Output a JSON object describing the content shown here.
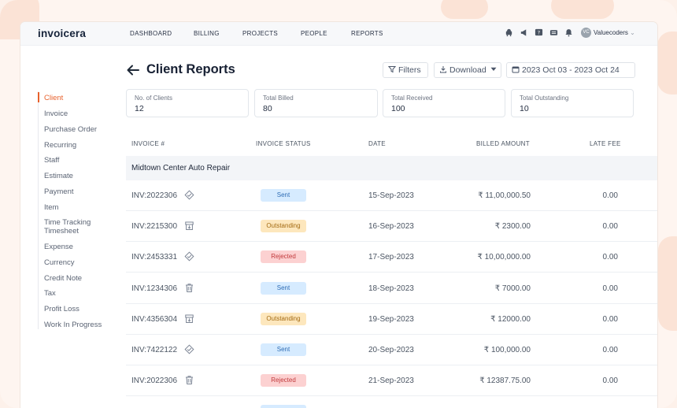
{
  "app": {
    "logo": "invoicera",
    "nav": [
      "DASHBOARD",
      "BILLING",
      "PROJECTS",
      "PEOPLE",
      "REPORTS"
    ],
    "user": {
      "avatar_initials": "VC",
      "name": "Valuecoders"
    },
    "icons": [
      "android-icon",
      "megaphone-icon",
      "help-icon",
      "keyboard-icon",
      "bell-icon"
    ]
  },
  "page": {
    "title": "Client Reports",
    "filters_label": "Filters",
    "download_label": "Download",
    "date_range": "2023 Oct 03 - 2023 Oct 24"
  },
  "sidebar": {
    "active": "Client",
    "items": [
      "Client",
      "Invoice",
      "Purchase Order",
      "Recurring",
      "Staff",
      "Estimate",
      "Payment",
      "Item",
      "Time Tracking Timesheet",
      "Expense",
      "Currency",
      "Credit Note",
      "Tax",
      "Profit Loss",
      "Work In Progress"
    ],
    "time_tracking_line1": "Time Tracking",
    "time_tracking_line2": "Timesheet"
  },
  "stats": [
    {
      "label": "No. of Clients",
      "value": "12"
    },
    {
      "label": "Total Billed",
      "value": "80"
    },
    {
      "label": "Total Received",
      "value": "100"
    },
    {
      "label": "Total Outstanding",
      "value": "10"
    }
  ],
  "table": {
    "columns": [
      "INVOICE #",
      "INVOICE STATUS",
      "DATE",
      "BILLED AMOUNT",
      "LATE FEE"
    ],
    "group": "Midtown Center Auto Repair",
    "rows": [
      {
        "invoice": "INV:2022306",
        "icon": "badge-check-icon",
        "status": "Sent",
        "date": "15-Sep-2023",
        "amount": "₹ 11,00,000.50",
        "fee": "0.00"
      },
      {
        "invoice": "INV:2215300",
        "icon": "archive-box-icon",
        "status": "Outstanding",
        "date": "16-Sep-2023",
        "amount": "₹ 2300.00",
        "fee": "0.00"
      },
      {
        "invoice": "INV:2453331",
        "icon": "badge-check-icon",
        "status": "Rejected",
        "date": "17-Sep-2023",
        "amount": "₹ 10,00,000.00",
        "fee": "0.00"
      },
      {
        "invoice": "INV:1234306",
        "icon": "trash-icon",
        "status": "Sent",
        "date": "18-Sep-2023",
        "amount": "₹ 7000.00",
        "fee": "0.00"
      },
      {
        "invoice": "INV:4356304",
        "icon": "archive-box-icon",
        "status": "Outstanding",
        "date": "19-Sep-2023",
        "amount": "₹ 12000.00",
        "fee": "0.00"
      },
      {
        "invoice": "INV:7422122",
        "icon": "badge-check-icon",
        "status": "Sent",
        "date": "20-Sep-2023",
        "amount": "₹ 100,000.00",
        "fee": "0.00"
      },
      {
        "invoice": "INV:2022306",
        "icon": "trash-icon",
        "status": "Rejected",
        "date": "21-Sep-2023",
        "amount": "₹ 12387.75.00",
        "fee": "0.00"
      }
    ]
  },
  "colors": {
    "accent": "#e8612c",
    "sent": "#d6ebff",
    "outstanding": "#fde7bd",
    "rejected": "#fcd1d1",
    "background": "#fdf1ea"
  }
}
